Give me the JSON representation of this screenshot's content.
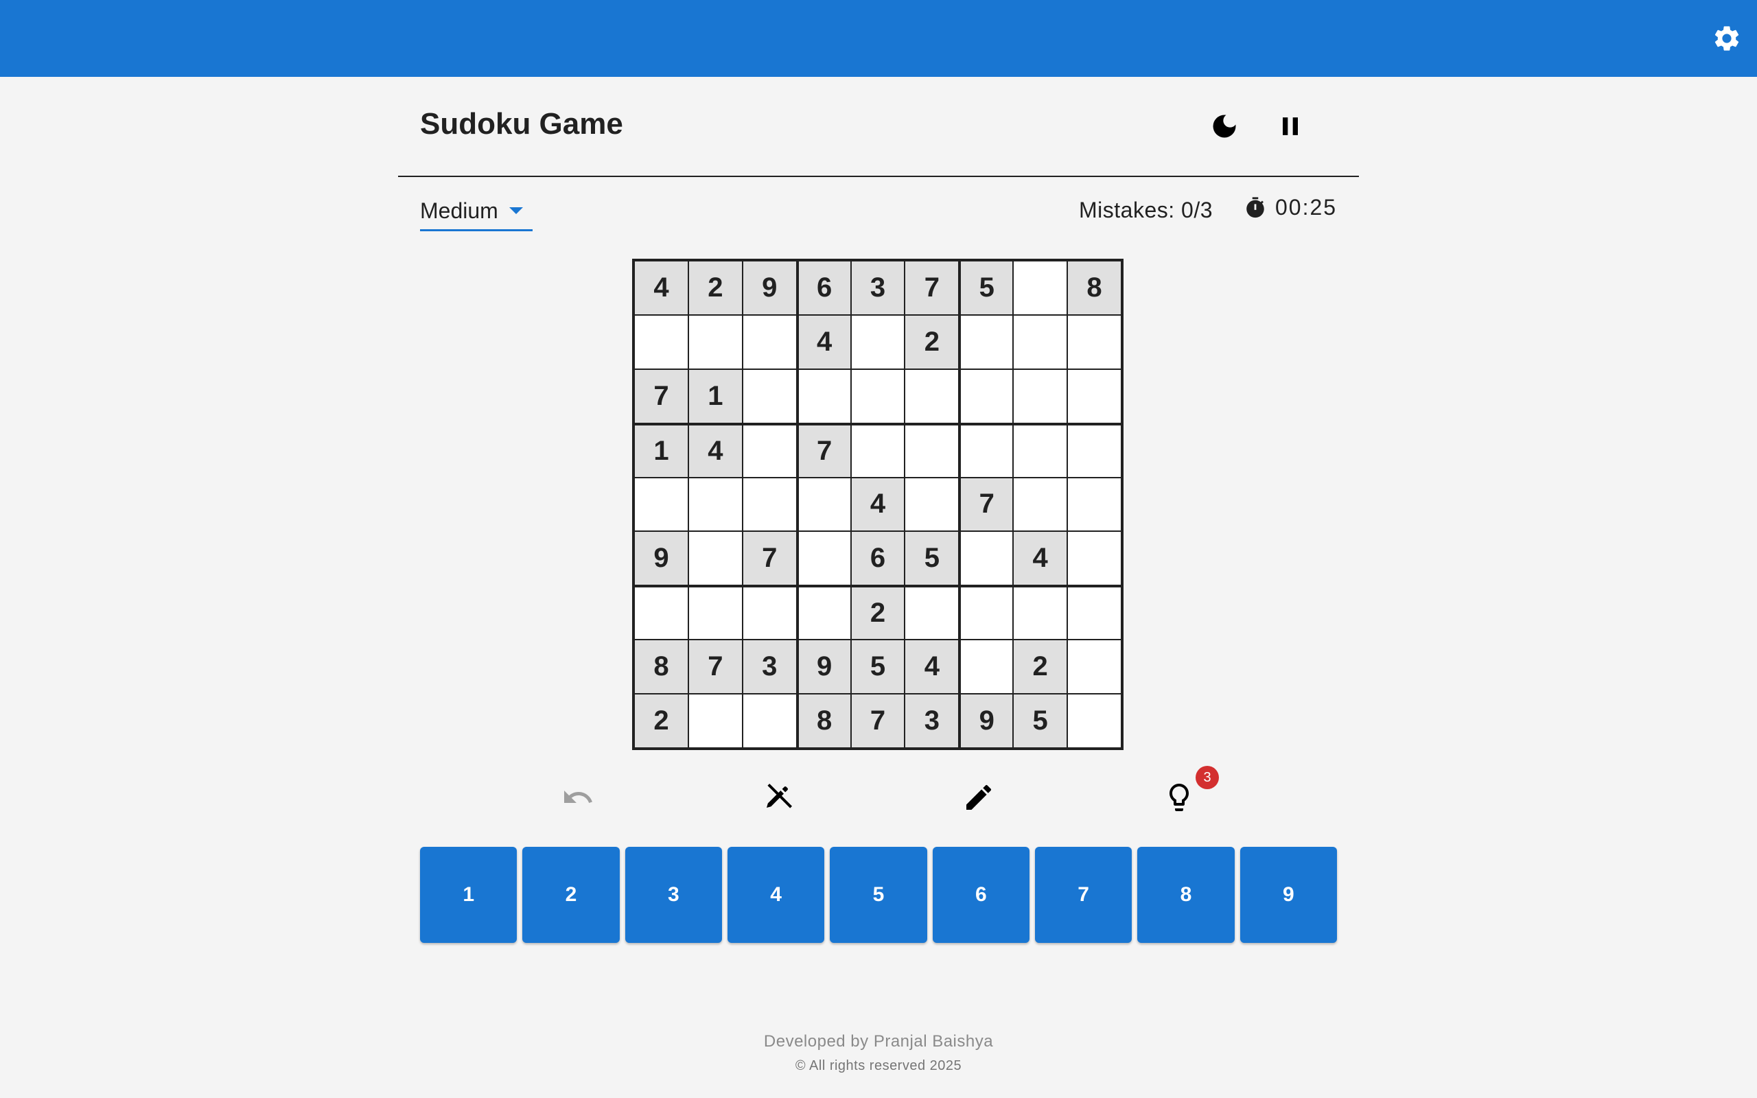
{
  "app_bar": {
    "settings_icon": "gear-icon",
    "color": "#1976d2"
  },
  "header": {
    "title": "Sudoku Game",
    "theme_icon": "moon-icon",
    "pause_icon": "pause-icon"
  },
  "status": {
    "difficulty": "Medium",
    "mistakes": "Mistakes: 0/3",
    "timer_icon": "stopwatch-icon",
    "timer": "00:25"
  },
  "board": [
    [
      "4",
      "2",
      "9",
      "6",
      "3",
      "7",
      "5",
      "",
      "8"
    ],
    [
      "",
      "",
      "",
      "4",
      "",
      "2",
      "",
      "",
      ""
    ],
    [
      "7",
      "1",
      "",
      "",
      "",
      "",
      "",
      "",
      ""
    ],
    [
      "1",
      "4",
      "",
      "7",
      "",
      "",
      "",
      "",
      ""
    ],
    [
      "",
      "",
      "",
      "",
      "4",
      "",
      "7",
      "",
      ""
    ],
    [
      "9",
      "",
      "7",
      "",
      "6",
      "5",
      "",
      "4",
      ""
    ],
    [
      "",
      "",
      "",
      "",
      "2",
      "",
      "",
      "",
      ""
    ],
    [
      "8",
      "7",
      "3",
      "9",
      "5",
      "4",
      "",
      "2",
      ""
    ],
    [
      "2",
      "",
      "",
      "8",
      "7",
      "3",
      "9",
      "5",
      ""
    ]
  ],
  "tools": {
    "undo_icon": "undo-icon",
    "erase_icon": "erase-icon",
    "notes_icon": "pencil-icon",
    "hint_icon": "lightbulb-icon",
    "hint_count": "3"
  },
  "numpad": [
    "1",
    "2",
    "3",
    "4",
    "5",
    "6",
    "7",
    "8",
    "9"
  ],
  "footer": {
    "developer": "Developed by Pranjal Baishya",
    "copyright": "© All rights reserved 2025"
  },
  "colors": {
    "primary": "#1976d2",
    "given_cell": "#e0e0e0",
    "badge": "#d32f2f"
  }
}
